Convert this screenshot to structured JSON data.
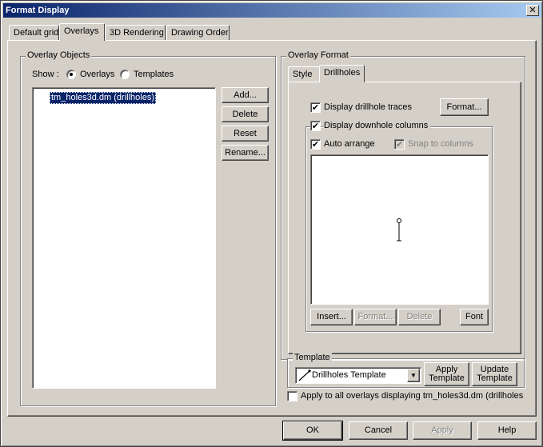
{
  "window": {
    "title": "Format Display",
    "close_glyph": "✕"
  },
  "tabs": [
    {
      "label": "Default grid"
    },
    {
      "label": "Overlays",
      "active": true
    },
    {
      "label": "3D Rendering"
    },
    {
      "label": "Drawing Order"
    }
  ],
  "overlay_objects": {
    "group_label": "Overlay Objects",
    "show_label": "Show :",
    "radio_overlays": "Overlays",
    "radio_templates": "Templates",
    "selected_radio": "Overlays",
    "items": [
      {
        "label": "tm_holes3d.dm (drillholes)",
        "icon": "drillhole-icon",
        "selected": true
      }
    ],
    "buttons": {
      "add": "Add...",
      "delete": "Delete",
      "reset": "Reset",
      "rename": "Rename..."
    }
  },
  "overlay_format": {
    "group_label": "Overlay Format",
    "tabs": [
      {
        "label": "Style"
      },
      {
        "label": "Drillholes",
        "active": true
      }
    ],
    "display_traces": {
      "label": "Display drillhole traces",
      "checked": true
    },
    "format_button": "Format...",
    "display_columns": {
      "label": "Display downhole columns",
      "checked": true
    },
    "auto_arrange": {
      "label": "Auto arrange",
      "checked": true
    },
    "snap_to_columns": {
      "label": "Snap to columns",
      "checked": true,
      "disabled": true
    },
    "column_buttons": {
      "insert": "Insert...",
      "format": "Format...",
      "delete": "Delete",
      "font": "Font"
    }
  },
  "template": {
    "group_label": "Template",
    "selected": "Drillholes Template",
    "apply_line1": "Apply",
    "apply_line2": "Template",
    "update_line1": "Update",
    "update_line2": "Template"
  },
  "apply_all": {
    "label": "Apply to all overlays displaying tm_holes3d.dm (drillholes",
    "checked": false
  },
  "footer": {
    "ok": "OK",
    "cancel": "Cancel",
    "apply": "Apply",
    "help": "Help"
  },
  "check_glyph": "✔",
  "dropdown_glyph": "▼"
}
